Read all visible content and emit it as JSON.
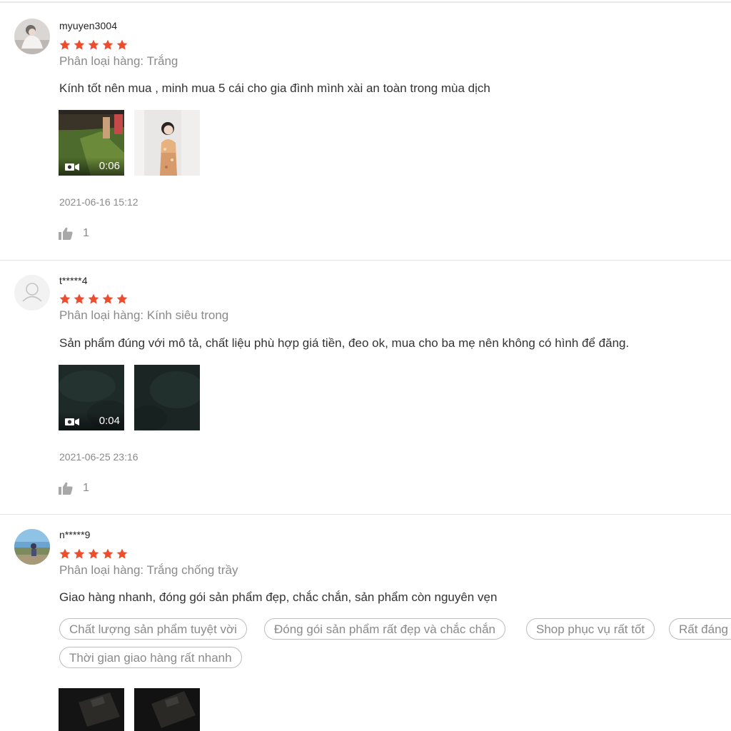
{
  "reviews": [
    {
      "username": "myuyen3004",
      "rating": 5,
      "variant": "Phân loại hàng: Trắng",
      "comment": "Kính tốt nên mua , minh mua 5 cái cho gia đình mình xài an toàn trong mùa dịch",
      "video_duration": "0:06",
      "timestamp": "2021-06-16 15:12",
      "likes": "1"
    },
    {
      "username": "t*****4",
      "rating": 5,
      "variant": "Phân loại hàng: Kính siêu trong",
      "comment": "Sản phẩm đúng với mô tả, chất liệu phù hợp giá tiền, đeo ok, mua cho ba mẹ nên không có hình để đăng.",
      "video_duration": "0:04",
      "timestamp": "2021-06-25 23:16",
      "likes": "1"
    },
    {
      "username": "n*****9",
      "rating": 5,
      "variant": "Phân loại hàng: Trắng chống trầy",
      "comment": "Giao hàng nhanh, đóng gói sản phẩm đẹp, chắc chắn, sản phẩm còn nguyên vẹn",
      "tags": [
        "Chất lượng sản phẩm tuyệt vời",
        "Đóng gói sản phẩm rất đẹp và chắc chắn",
        "Shop phục vụ rất tốt",
        "Rất đáng",
        "Thời gian giao hàng rất nhanh"
      ]
    }
  ],
  "colors": {
    "star": "#ee4d2d",
    "muted_text": "#8a8a8a",
    "divider": "#e5e5e5"
  },
  "icons": {
    "star": "star-icon",
    "like": "thumbs-up-icon",
    "video": "video-camera-icon",
    "default_avatar": "user-icon"
  }
}
